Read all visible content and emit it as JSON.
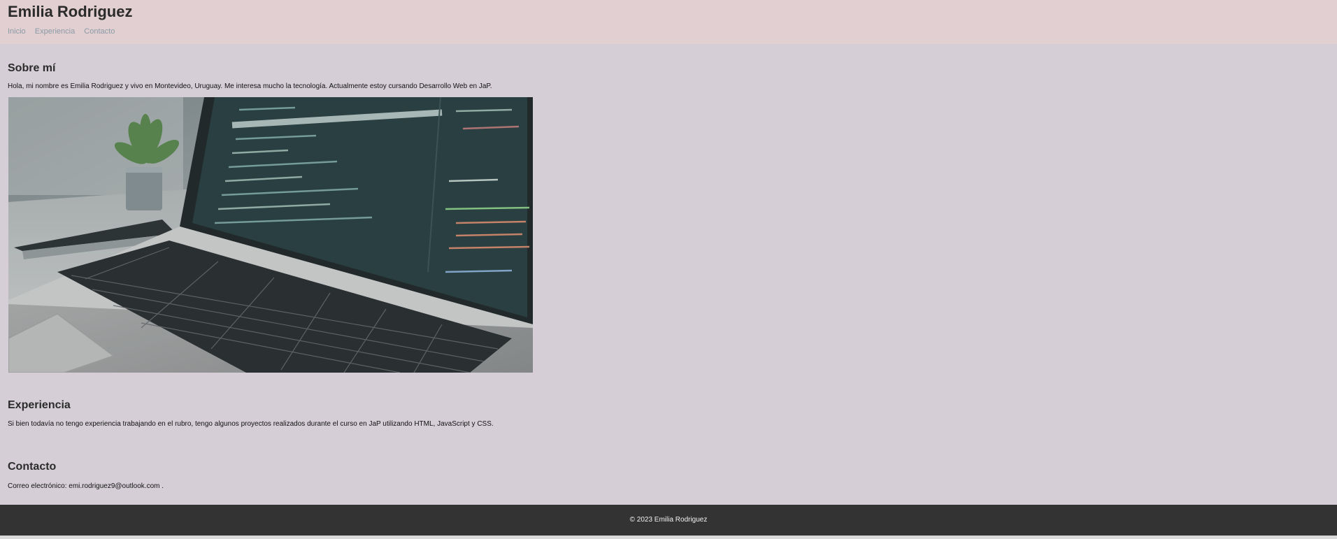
{
  "header": {
    "title": "Emilia Rodriguez",
    "nav": [
      "Inicio",
      "Experiencia",
      "Contacto"
    ]
  },
  "about": {
    "title": "Sobre mí",
    "text": "Hola, mi nombre es Emilia Rodriguez y vivo en Montevideo, Uruguay. Me interesa mucho la tecnología. Actualmente estoy cursando Desarrollo Web en JaP.",
    "image_icon": "laptop-with-code-photo"
  },
  "experience": {
    "title": "Experiencia",
    "text": "Si bien todavía no tengo experiencia trabajando en el rubro, tengo algunos proyectos realizados durante el curso en JaP utilizando HTML, JavaScript y CSS."
  },
  "contact": {
    "title": "Contacto",
    "label": "Correo electrónico:",
    "email": "emi.rodriguez9@outlook.com",
    "trailing": "."
  },
  "footer": {
    "copyright": "© 2023 Emilia Rodriguez"
  },
  "colors": {
    "header_bg": "#e2cfd1",
    "page_bg": "#d5ced6",
    "footer_bg": "#333333",
    "nav_link": "#8a9aa6"
  }
}
